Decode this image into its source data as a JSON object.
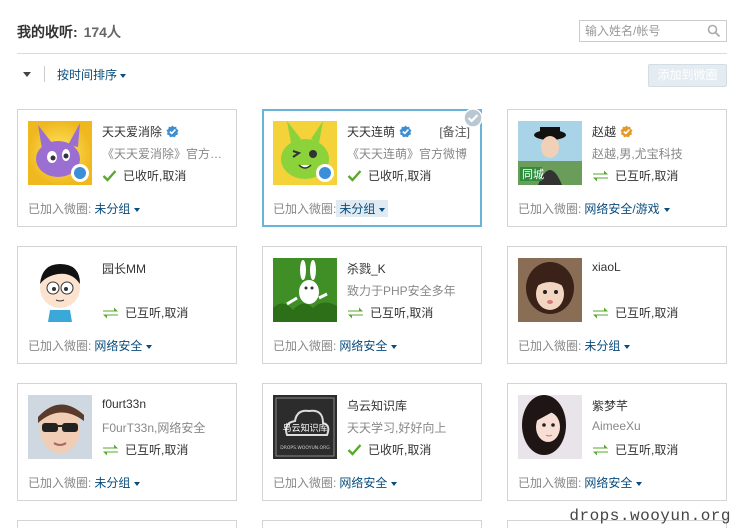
{
  "header": {
    "title": "我的收听:",
    "count": "174人",
    "search_placeholder": "输入姓名/帐号"
  },
  "toolbar": {
    "sort_label": "按时间排序",
    "add_button": "添加到微圈"
  },
  "card_labels": {
    "group_prefix": "已加入微圈:",
    "cancel": "取消"
  },
  "cards": [
    {
      "name": "天天爱消除",
      "verified": "blue",
      "desc": "《天天爱消除》官方微博",
      "status": "已收听,",
      "status_type": "follow",
      "group": "未分组",
      "avatar": "game-bunny-purple-avatar"
    },
    {
      "name": "天天连萌",
      "verified": "blue",
      "note": "[备注]",
      "desc": "《天天连萌》官方微博",
      "status": "已收听,",
      "status_type": "follow",
      "group": "未分组",
      "avatar": "game-bunny-green-avatar",
      "selected": true
    },
    {
      "name": "赵越",
      "verified": "orange",
      "desc": "赵越,男,尤宝科技",
      "status": "已互听,",
      "status_type": "mutual",
      "group": "网络安全/游戏",
      "avatar": "girl-hat-photo-avatar"
    },
    {
      "name": "园长MM",
      "verified": "",
      "desc": "",
      "status": "已互听,",
      "status_type": "mutual",
      "group": "网络安全",
      "avatar": "cartoon-boy-avatar"
    },
    {
      "name": "杀戮_K",
      "verified": "",
      "desc": "致力于PHP安全多年",
      "status": "已互听,",
      "status_type": "mutual",
      "group": "网络安全",
      "avatar": "grass-rabbit-avatar"
    },
    {
      "name": "xiaoL",
      "verified": "",
      "desc": "",
      "status": "已互听,",
      "status_type": "mutual",
      "group": "未分组",
      "avatar": "child-photo-avatar"
    },
    {
      "name": "f0urt33n",
      "verified": "",
      "desc": "F0urT33n,网络安全",
      "status": "已互听,",
      "status_type": "mutual",
      "group": "未分组",
      "avatar": "sunglasses-photo-avatar"
    },
    {
      "name": "乌云知识库",
      "verified": "",
      "desc": "天天学习,好好向上",
      "status": "已收听,",
      "status_type": "follow",
      "group": "网络安全",
      "avatar": "wooyun-cloud-logo-avatar",
      "avatar_text": "乌云知识库",
      "avatar_sub": "DROPS.WOOYUN.ORG"
    },
    {
      "name": "紫梦芊",
      "verified": "",
      "desc": "AimeeXu",
      "status": "已互听,",
      "status_type": "mutual",
      "group": "网络安全",
      "avatar": "girl-photo-avatar"
    }
  ],
  "watermark": "drops.wooyun.org",
  "colors": {
    "link": "#0a4c7c",
    "verified_blue": "#3d8fd1",
    "verified_orange": "#e39a2a",
    "check_green": "#5aa82e",
    "select_border": "#6bb3d9"
  }
}
